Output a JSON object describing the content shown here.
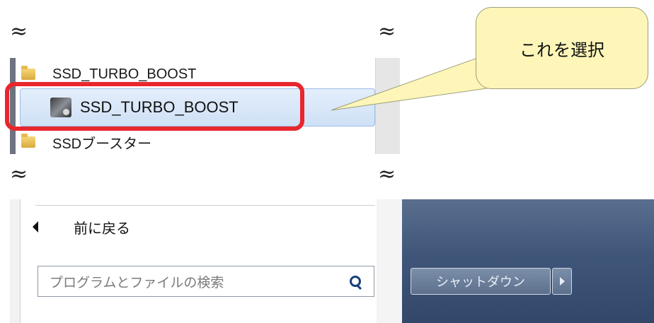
{
  "menu": {
    "items": [
      {
        "label": "SSD_TURBO_BOOST",
        "icon": "folder-icon"
      },
      {
        "label": "SSD_TURBO_BOOST",
        "icon": "app-icon",
        "selected": true
      },
      {
        "label": "SSDブースター",
        "icon": "folder-icon"
      }
    ],
    "back_label": "前に戻る"
  },
  "callout": {
    "text": "これを選択"
  },
  "search": {
    "placeholder": "プログラムとファイルの検索"
  },
  "shutdown": {
    "label": "シャットダウン"
  },
  "cut_mark": "≈",
  "colors": {
    "highlight_border": "#e8262d",
    "callout_fill": "#fdf6b8",
    "selected_row": "#d6e5f8"
  }
}
